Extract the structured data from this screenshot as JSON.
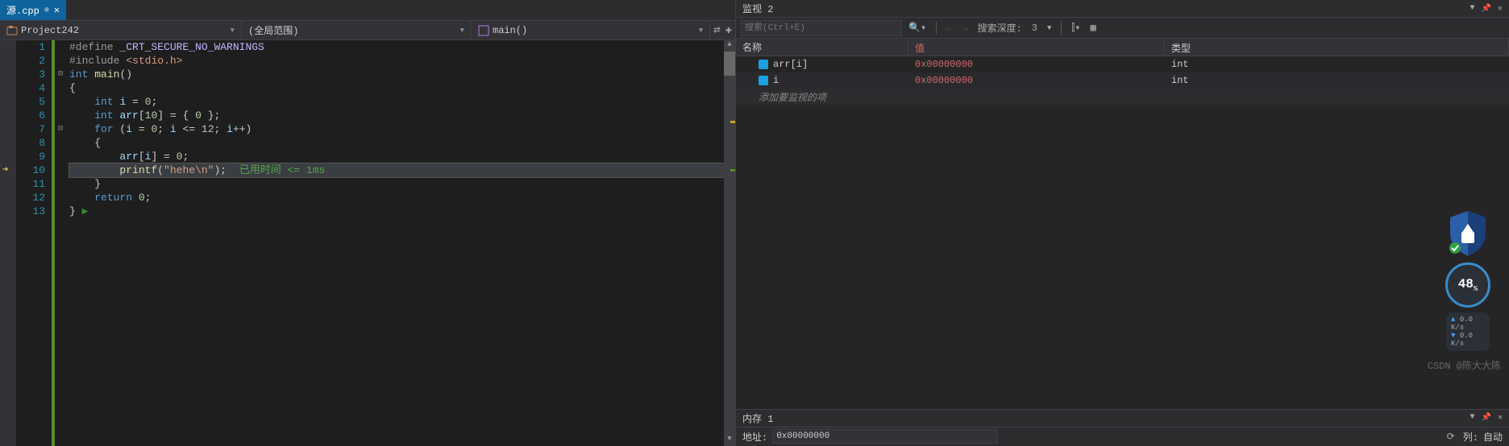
{
  "tab": {
    "filename": "源.cpp"
  },
  "breadcrumb": {
    "project": "Project242",
    "scope": "(全局范围)",
    "func": "main()"
  },
  "editor": {
    "lines": [
      {
        "num": 1,
        "fold": "",
        "html": "<span class='pp'>#define</span> <span class='mac'>_CRT_SECURE_NO_WARNINGS</span>"
      },
      {
        "num": 2,
        "fold": "",
        "html": "<span class='pp'>#include</span> <span class='str'>&lt;stdio.h&gt;</span>"
      },
      {
        "num": 3,
        "fold": "⊟",
        "html": "<span class='kw'>int</span> <span class='fn'>main</span>()"
      },
      {
        "num": 4,
        "fold": "",
        "html": "{"
      },
      {
        "num": 5,
        "fold": "",
        "html": "    <span class='kw'>int</span> <span class='var'>i</span> = <span class='num'>0</span>;"
      },
      {
        "num": 6,
        "fold": "",
        "html": "    <span class='kw'>int</span> <span class='var'>arr</span>[<span class='num'>10</span>] = { <span class='num'>0</span> };"
      },
      {
        "num": 7,
        "fold": "⊟",
        "html": "    <span class='kw'>for</span> (<span class='var'>i</span> = <span class='num'>0</span>; <span class='var'>i</span> &lt;= <span class='num'>12</span>; <span class='var'>i</span>++)"
      },
      {
        "num": 8,
        "fold": "",
        "html": "    {"
      },
      {
        "num": 9,
        "fold": "",
        "html": "        <span class='var'>arr</span>[<span class='var'>i</span>] = <span class='num'>0</span>;"
      },
      {
        "num": 10,
        "fold": "",
        "current": true,
        "bp": true,
        "html": "        <span class='fn'>printf</span>(<span class='str'>\"hehe\\n\"</span>);  <span class='cmt'>已用时间 &lt;= 1ms</span>"
      },
      {
        "num": 11,
        "fold": "",
        "html": "    }"
      },
      {
        "num": 12,
        "fold": "",
        "html": "    <span class='kw'>return</span> <span class='num'>0</span>;"
      },
      {
        "num": 13,
        "fold": "",
        "html": "} <span style='color:#388a34'>▶</span>"
      }
    ]
  },
  "watch": {
    "title": "监视 2",
    "search_placeholder": "搜索(Ctrl+E)",
    "depth_label": "搜索深度:",
    "depth_value": "3",
    "columns": {
      "name": "名称",
      "value": "值",
      "type": "类型"
    },
    "rows": [
      {
        "name": "arr[i]",
        "value": "0x00000000",
        "type": "int"
      },
      {
        "name": "i",
        "value": "0x00000000",
        "type": "int"
      }
    ],
    "add_item": "添加要监视的项"
  },
  "memory": {
    "title": "内存 1",
    "addr_label": "地址:",
    "addr_value": "0x00000000",
    "col_label": "列:",
    "col_value": "自动"
  },
  "overlay": {
    "percent": "48",
    "upload": "0.0 K/s",
    "download": "0.0 K/s"
  },
  "watermark": "CSDN @陈大大陈"
}
